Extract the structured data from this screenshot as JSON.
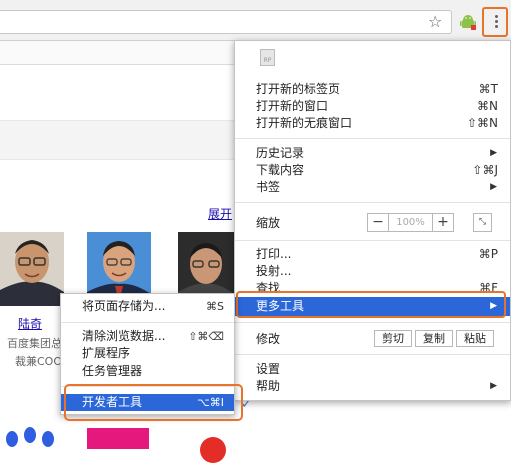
{
  "toolbar": {
    "bookmark_star": "☆",
    "menu_icon": "three-dots-vertical"
  },
  "page": {
    "expand_link": "展开",
    "person_name": "陆奇",
    "person_desc_line1": "百度集团总",
    "person_desc_line2": "裁兼COO"
  },
  "main_menu": {
    "placeholder_icon": "RP",
    "items": {
      "new_tab": {
        "label": "打开新的标签页",
        "shortcut": "⌘T"
      },
      "new_window": {
        "label": "打开新的窗口",
        "shortcut": "⌘N"
      },
      "new_incognito": {
        "label": "打开新的无痕窗口",
        "shortcut": "⇧⌘N"
      },
      "history": {
        "label": "历史记录"
      },
      "downloads": {
        "label": "下载内容",
        "shortcut": "⇧⌘J"
      },
      "bookmarks": {
        "label": "书签"
      },
      "zoom": {
        "label": "缩放",
        "minus": "−",
        "value": "100%",
        "plus": "+"
      },
      "print": {
        "label": "打印...",
        "shortcut": "⌘P"
      },
      "cast": {
        "label": "投射..."
      },
      "find": {
        "label": "查找",
        "shortcut": "⌘F"
      },
      "more_tools": {
        "label": "更多工具"
      },
      "edit": {
        "label": "修改",
        "cut": "剪切",
        "copy": "复制",
        "paste": "粘贴"
      },
      "settings": {
        "label": "设置"
      },
      "help": {
        "label": "帮助"
      }
    },
    "arrow": "▶"
  },
  "sub_menu": {
    "save_page": {
      "label": "将页面存储为...",
      "shortcut": "⌘S"
    },
    "clear_data": {
      "label": "清除浏览数据...",
      "shortcut": "⇧⌘⌫"
    },
    "extensions": {
      "label": "扩展程序"
    },
    "task_manager": {
      "label": "任务管理器"
    },
    "dev_tools": {
      "label": "开发者工具",
      "shortcut": "⌥⌘I"
    }
  },
  "colors": {
    "highlight": "#2b67d8",
    "callout": "#e8742c",
    "link": "#1a0dab"
  }
}
